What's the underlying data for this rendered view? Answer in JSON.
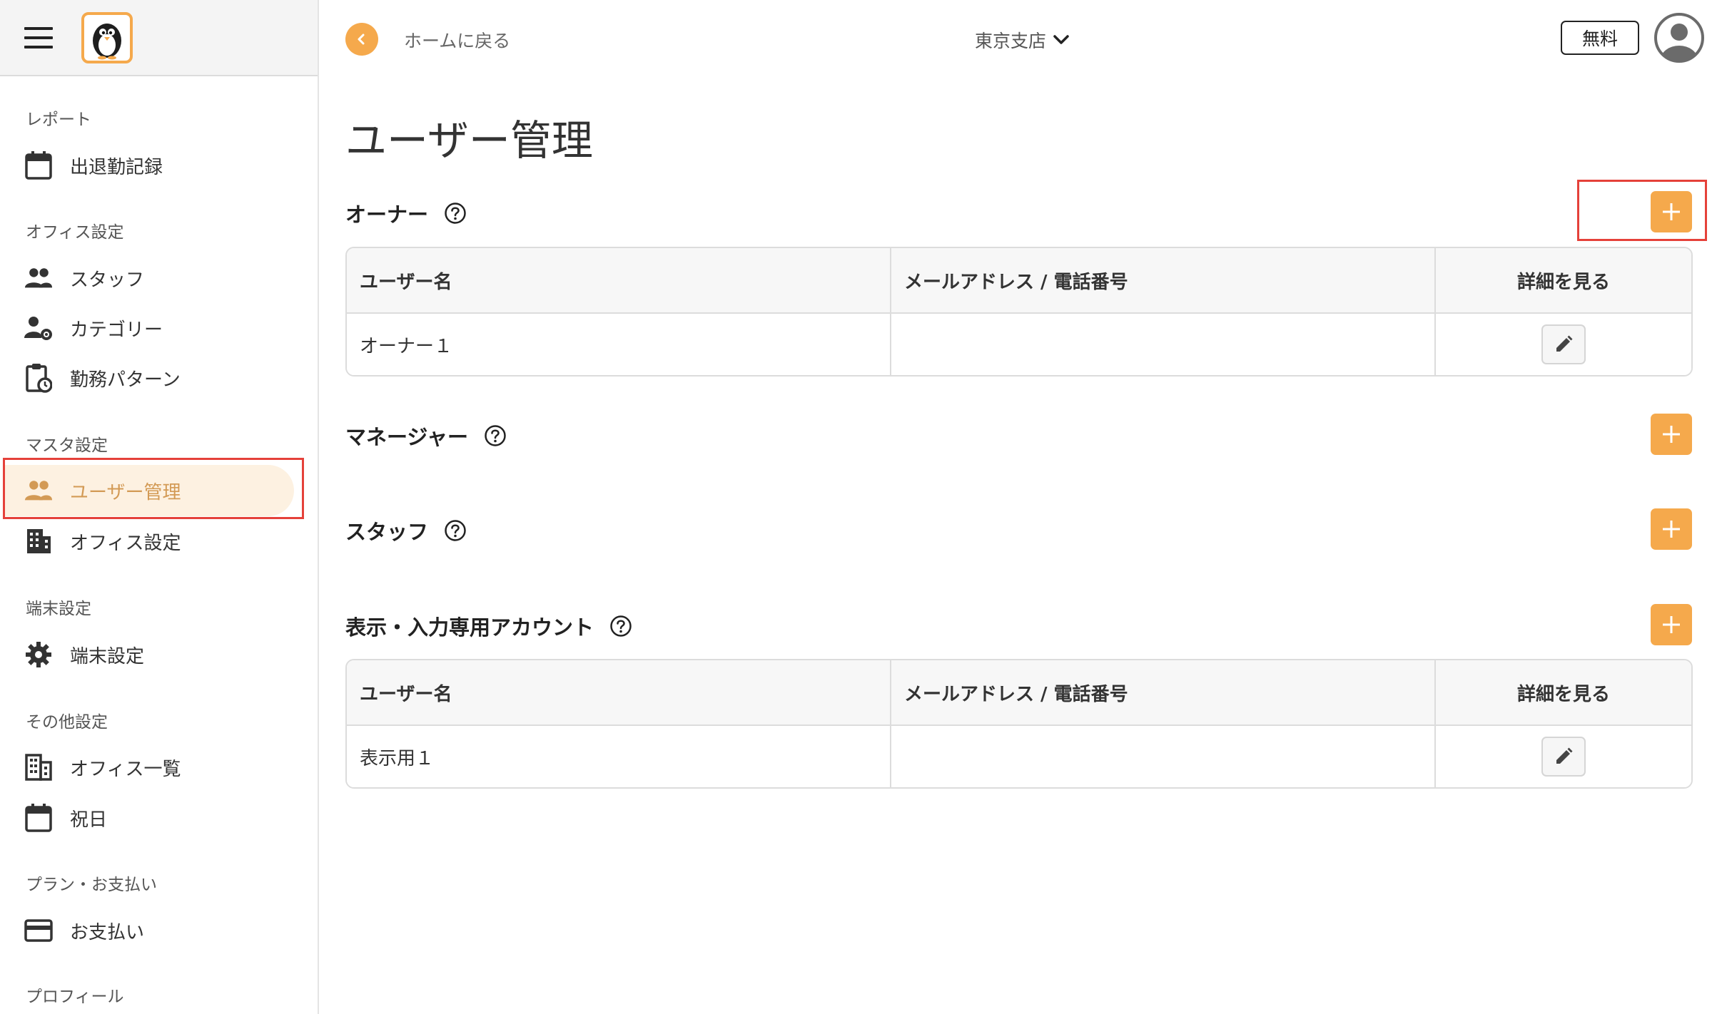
{
  "sidebar": {
    "sections": [
      {
        "label": "レポート",
        "items": [
          {
            "label": "出退勤記録",
            "icon": "calendar-icon"
          }
        ]
      },
      {
        "label": "オフィス設定",
        "items": [
          {
            "label": "スタッフ",
            "icon": "people-icon"
          },
          {
            "label": "カテゴリー",
            "icon": "user-settings-icon"
          },
          {
            "label": "勤務パターン",
            "icon": "clipboard-clock-icon"
          }
        ]
      },
      {
        "label": "マスタ設定",
        "items": [
          {
            "label": "ユーザー管理",
            "icon": "people-icon",
            "active": true
          },
          {
            "label": "オフィス設定",
            "icon": "building-icon"
          }
        ]
      },
      {
        "label": "端末設定",
        "items": [
          {
            "label": "端末設定",
            "icon": "gear-icon"
          }
        ]
      },
      {
        "label": "その他設定",
        "items": [
          {
            "label": "オフィス一覧",
            "icon": "office-list-icon"
          },
          {
            "label": "祝日",
            "icon": "calendar-icon"
          }
        ]
      },
      {
        "label": "プラン・お支払い",
        "items": [
          {
            "label": "お支払い",
            "icon": "credit-card-icon"
          }
        ]
      },
      {
        "label": "プロフィール",
        "items": []
      }
    ]
  },
  "header": {
    "back_label": "ホームに戻る",
    "branch": "東京支店",
    "plan_label": "無料"
  },
  "page": {
    "title": "ユーザー管理",
    "sections": [
      {
        "title": "オーナー",
        "table": {
          "headers": [
            "ユーザー名",
            "メールアドレス / 電話番号",
            "詳細を見る"
          ],
          "rows": [
            {
              "name": "オーナー１",
              "contact": ""
            }
          ]
        }
      },
      {
        "title": "マネージャー"
      },
      {
        "title": "スタッフ"
      },
      {
        "title": "表示・入力専用アカウント",
        "table": {
          "headers": [
            "ユーザー名",
            "メールアドレス / 電話番号",
            "詳細を見る"
          ],
          "rows": [
            {
              "name": "表示用１",
              "contact": ""
            }
          ]
        }
      }
    ]
  },
  "colors": {
    "accent": "#f5a94c",
    "active_bg": "#fdf1e1",
    "active_text": "#d39a55",
    "highlight": "#e5413a"
  }
}
